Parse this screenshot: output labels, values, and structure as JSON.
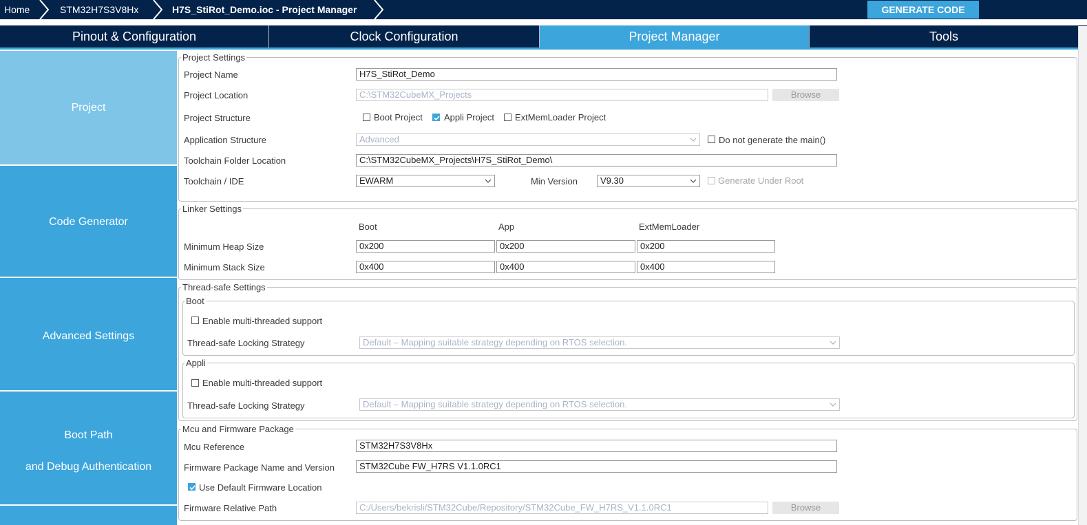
{
  "breadcrumb": {
    "home": "Home",
    "mcu": "STM32H7S3V8Hx",
    "project": "H7S_StiRot_Demo.ioc - Project Manager"
  },
  "generate_button": "GENERATE CODE",
  "tabs": [
    "Pinout & Configuration",
    "Clock Configuration",
    "Project Manager",
    "Tools"
  ],
  "sidebar": {
    "items": [
      "Project",
      "Code Generator",
      "Advanced Settings"
    ],
    "boot_path_line1": "Boot Path",
    "boot_path_line2": "and Debug Authentication"
  },
  "project_settings": {
    "title": "Project Settings",
    "name_label": "Project Name",
    "name_value": "H7S_StiRot_Demo",
    "location_label": "Project Location",
    "location_value": "C:\\STM32CubeMX_Projects",
    "browse": "Browse",
    "structure_label": "Project Structure",
    "boot_project": "Boot Project",
    "appli_project": "Appli Project",
    "extmem_project": "ExtMemLoader Project",
    "app_structure_label": "Application Structure",
    "app_structure_value": "Advanced",
    "no_main": "Do not generate the main()",
    "toolchain_folder_label": "Toolchain Folder Location",
    "toolchain_folder_value": "C:\\STM32CubeMX_Projects\\H7S_StiRot_Demo\\",
    "toolchain_label": "Toolchain / IDE",
    "toolchain_value": "EWARM",
    "min_version_label": "Min Version",
    "min_version_value": "V9.30",
    "generate_under_root": "Generate Under Root"
  },
  "linker": {
    "title": "Linker Settings",
    "col_boot": "Boot",
    "col_app": "App",
    "col_ext": "ExtMemLoader",
    "heap_label": "Minimum Heap Size",
    "heap": [
      "0x200",
      "0x200",
      "0x200"
    ],
    "stack_label": "Minimum Stack Size",
    "stack": [
      "0x400",
      "0x400",
      "0x400"
    ]
  },
  "thread_safe": {
    "title": "Thread-safe Settings",
    "boot_title": "Boot",
    "appli_title": "Appli",
    "enable_mt": "Enable multi-threaded support",
    "strategy_label": "Thread-safe Locking Strategy",
    "strategy_value": "Default – Mapping suitable strategy depending on RTOS selection."
  },
  "mcu_fw": {
    "title": "Mcu and Firmware Package",
    "ref_label": "Mcu Reference",
    "ref_value": "STM32H7S3V8Hx",
    "pkg_label": "Firmware Package Name and Version",
    "pkg_value": "STM32Cube FW_H7RS V1.1.0RC1",
    "use_default": "Use Default Firmware Location",
    "path_label": "Firmware Relative Path",
    "path_value": "C:/Users/bekrisli/STM32Cube/Repository/STM32Cube_FW_H7RS_V1.1.0RC1",
    "browse": "Browse"
  },
  "colors": {
    "dark_navy": "#03234b",
    "accent_blue": "#3ca5dc",
    "sidebar_active": "#7fc5e8"
  }
}
